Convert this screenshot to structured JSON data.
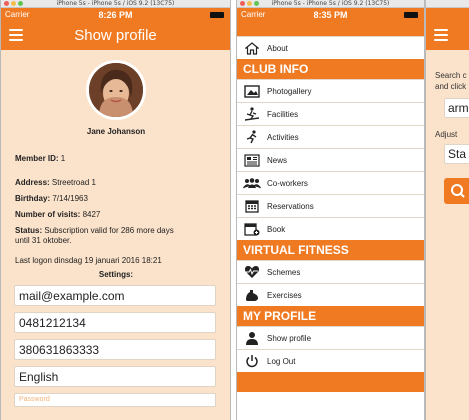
{
  "window_left": {
    "title": "iPhone 5s - iPhone 5s / iOS 9.2 (13C75)"
  },
  "window_mid": {
    "title": "iPhone 5s - iPhone 5s / iOS 9.2 (13C75)"
  },
  "status_left": {
    "carrier": "Carrier",
    "time": "8:26 PM"
  },
  "status_mid": {
    "carrier": "Carrier",
    "time": "8:35 PM"
  },
  "profile": {
    "header_title": "Show profile",
    "name": "Jane Johanson",
    "member_id_label": "Member ID:",
    "member_id": "1",
    "address_label": "Address:",
    "address": "Streetroad 1",
    "birthday_label": "Birthday:",
    "birthday": "7/14/1963",
    "visits_label": "Number of visits:",
    "visits": "8427",
    "status_label": "Status:",
    "status_line1": "Subscription valid for 286 more days",
    "status_line2": "until 31 oktober.",
    "last_logon": "Last logon dinsdag 19 januari 2016 18:21",
    "settings_title": "Settings:",
    "email": "mail@example.com",
    "phone1": "0481212134",
    "phone2": "380631863333",
    "language": "English",
    "password_placeholder": "Password"
  },
  "menu": {
    "about": "About",
    "club_info_header": "CLUB INFO",
    "photogallery": "Photogallery",
    "facilities": "Facilities",
    "activities": "Activities",
    "news": "News",
    "coworkers": "Co-workers",
    "reservations": "Reservations",
    "book": "Book",
    "virtual_fitness_header": "VIRTUAL FITNESS",
    "schemes": "Schemes",
    "exercises": "Exercises",
    "my_profile_header": "MY PROFILE",
    "show_profile": "Show profile",
    "logout": "Log Out"
  },
  "partial": {
    "line1": "Search c",
    "line2": "and click",
    "value1": "arm",
    "adjust": "Adjust",
    "value2": "Sta"
  },
  "colors": {
    "accent": "#f07a22",
    "background": "#fbe3cb"
  }
}
